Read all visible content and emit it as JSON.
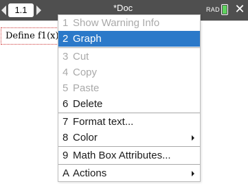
{
  "titlebar": {
    "page_tab": "1.1",
    "doc_title": "*Doc",
    "angle_mode": "RAD"
  },
  "document": {
    "expression": "Define f1(x)="
  },
  "context_menu": {
    "items": [
      {
        "key": "1",
        "label": "Show Warning Info",
        "state": "disabled",
        "submenu": false
      },
      {
        "key": "2",
        "label": "Graph",
        "state": "selected",
        "submenu": false
      },
      {
        "key": "3",
        "label": "Cut",
        "state": "disabled",
        "submenu": false
      },
      {
        "key": "4",
        "label": "Copy",
        "state": "disabled",
        "submenu": false
      },
      {
        "key": "5",
        "label": "Paste",
        "state": "disabled",
        "submenu": false
      },
      {
        "key": "6",
        "label": "Delete",
        "state": "enabled",
        "submenu": false
      },
      {
        "key": "7",
        "label": "Format text...",
        "state": "enabled",
        "submenu": false
      },
      {
        "key": "8",
        "label": "Color",
        "state": "enabled",
        "submenu": true
      },
      {
        "key": "9",
        "label": "Math Box Attributes...",
        "state": "enabled",
        "submenu": false
      },
      {
        "key": "A",
        "label": "Actions",
        "state": "enabled",
        "submenu": true
      }
    ]
  },
  "colors": {
    "titlebar_bg": "#4f4f4f",
    "selection_bg": "#2b79c9",
    "disabled_text": "#a9a9a9",
    "battery_fill": "#5ed35e"
  },
  "icons": {
    "prev_page": "triangle-left",
    "next_page": "triangle-right",
    "battery": "battery-full",
    "close": "x-mark"
  }
}
